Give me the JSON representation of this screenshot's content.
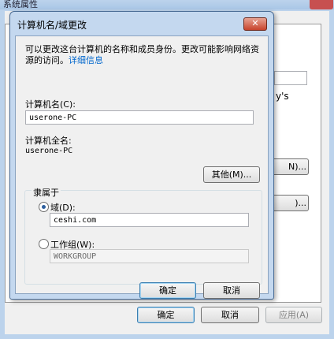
{
  "background_window": {
    "title": "系统属性",
    "partial_text": "y's",
    "partial_button_1": "N)...",
    "partial_button_2": ")...",
    "buttons": {
      "ok": "确定",
      "cancel": "取消",
      "apply": "应用(A)"
    }
  },
  "dialog": {
    "title": "计算机名/域更改",
    "close_glyph": "✕",
    "description": "可以更改这台计算机的名称和成员身份。更改可能影响网络资源的访问。",
    "details_link": "详细信息",
    "computer_name_label": "计算机名(C):",
    "computer_name_value": "userone-PC",
    "full_name_label": "计算机全名:",
    "full_name_value": "userone-PC",
    "more_button": "其他(M)...",
    "member_of_label": "隶属于",
    "domain_label": "域(D):",
    "domain_value": "ceshi.com",
    "workgroup_label": "工作组(W):",
    "workgroup_value": "WORKGROUP",
    "selected_membership": "domain",
    "ok_button": "确定",
    "cancel_button": "取消"
  }
}
